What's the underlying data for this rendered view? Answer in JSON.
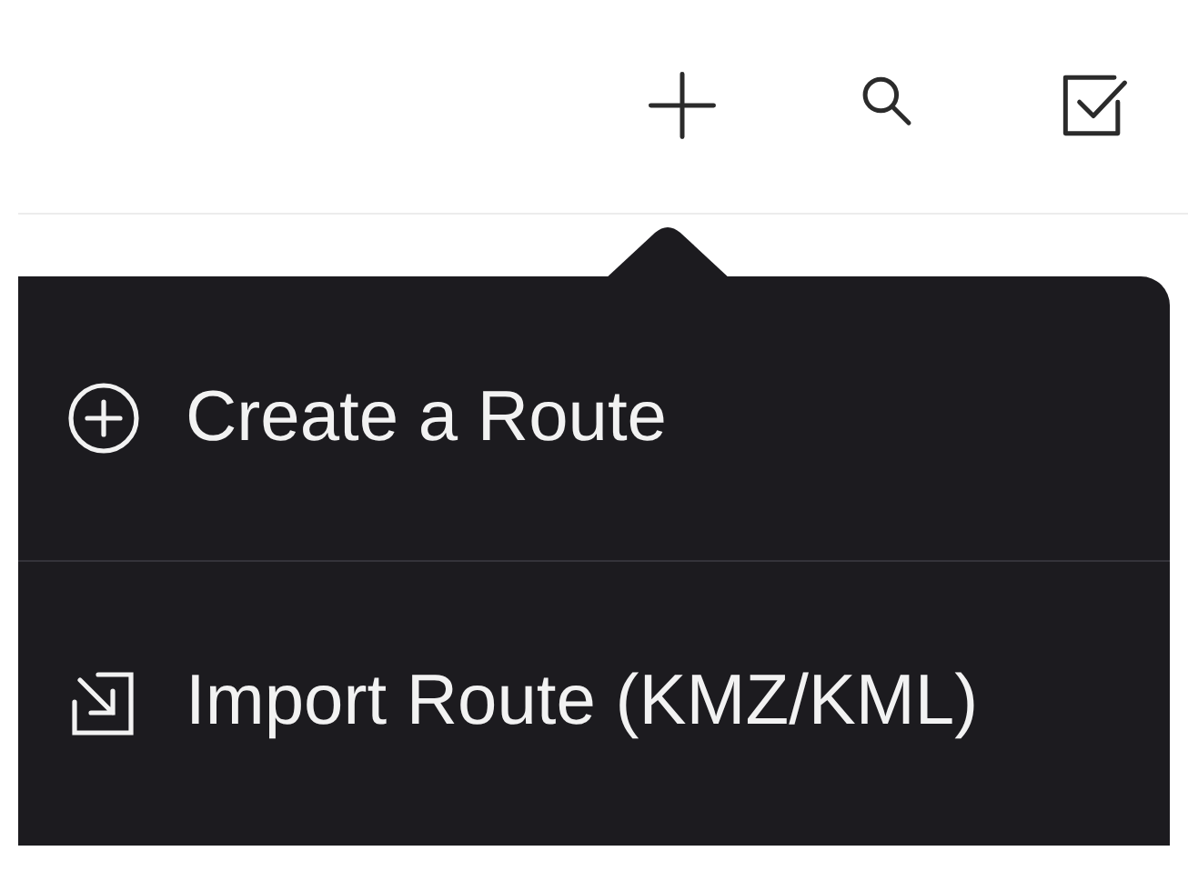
{
  "toolbar": {
    "actions": [
      {
        "kind": "add"
      },
      {
        "kind": "search"
      },
      {
        "kind": "select"
      }
    ]
  },
  "menu": {
    "items": [
      {
        "kind": "create",
        "label": "Create a Route"
      },
      {
        "kind": "import",
        "label": "Import Route (KMZ/KML)"
      }
    ]
  }
}
